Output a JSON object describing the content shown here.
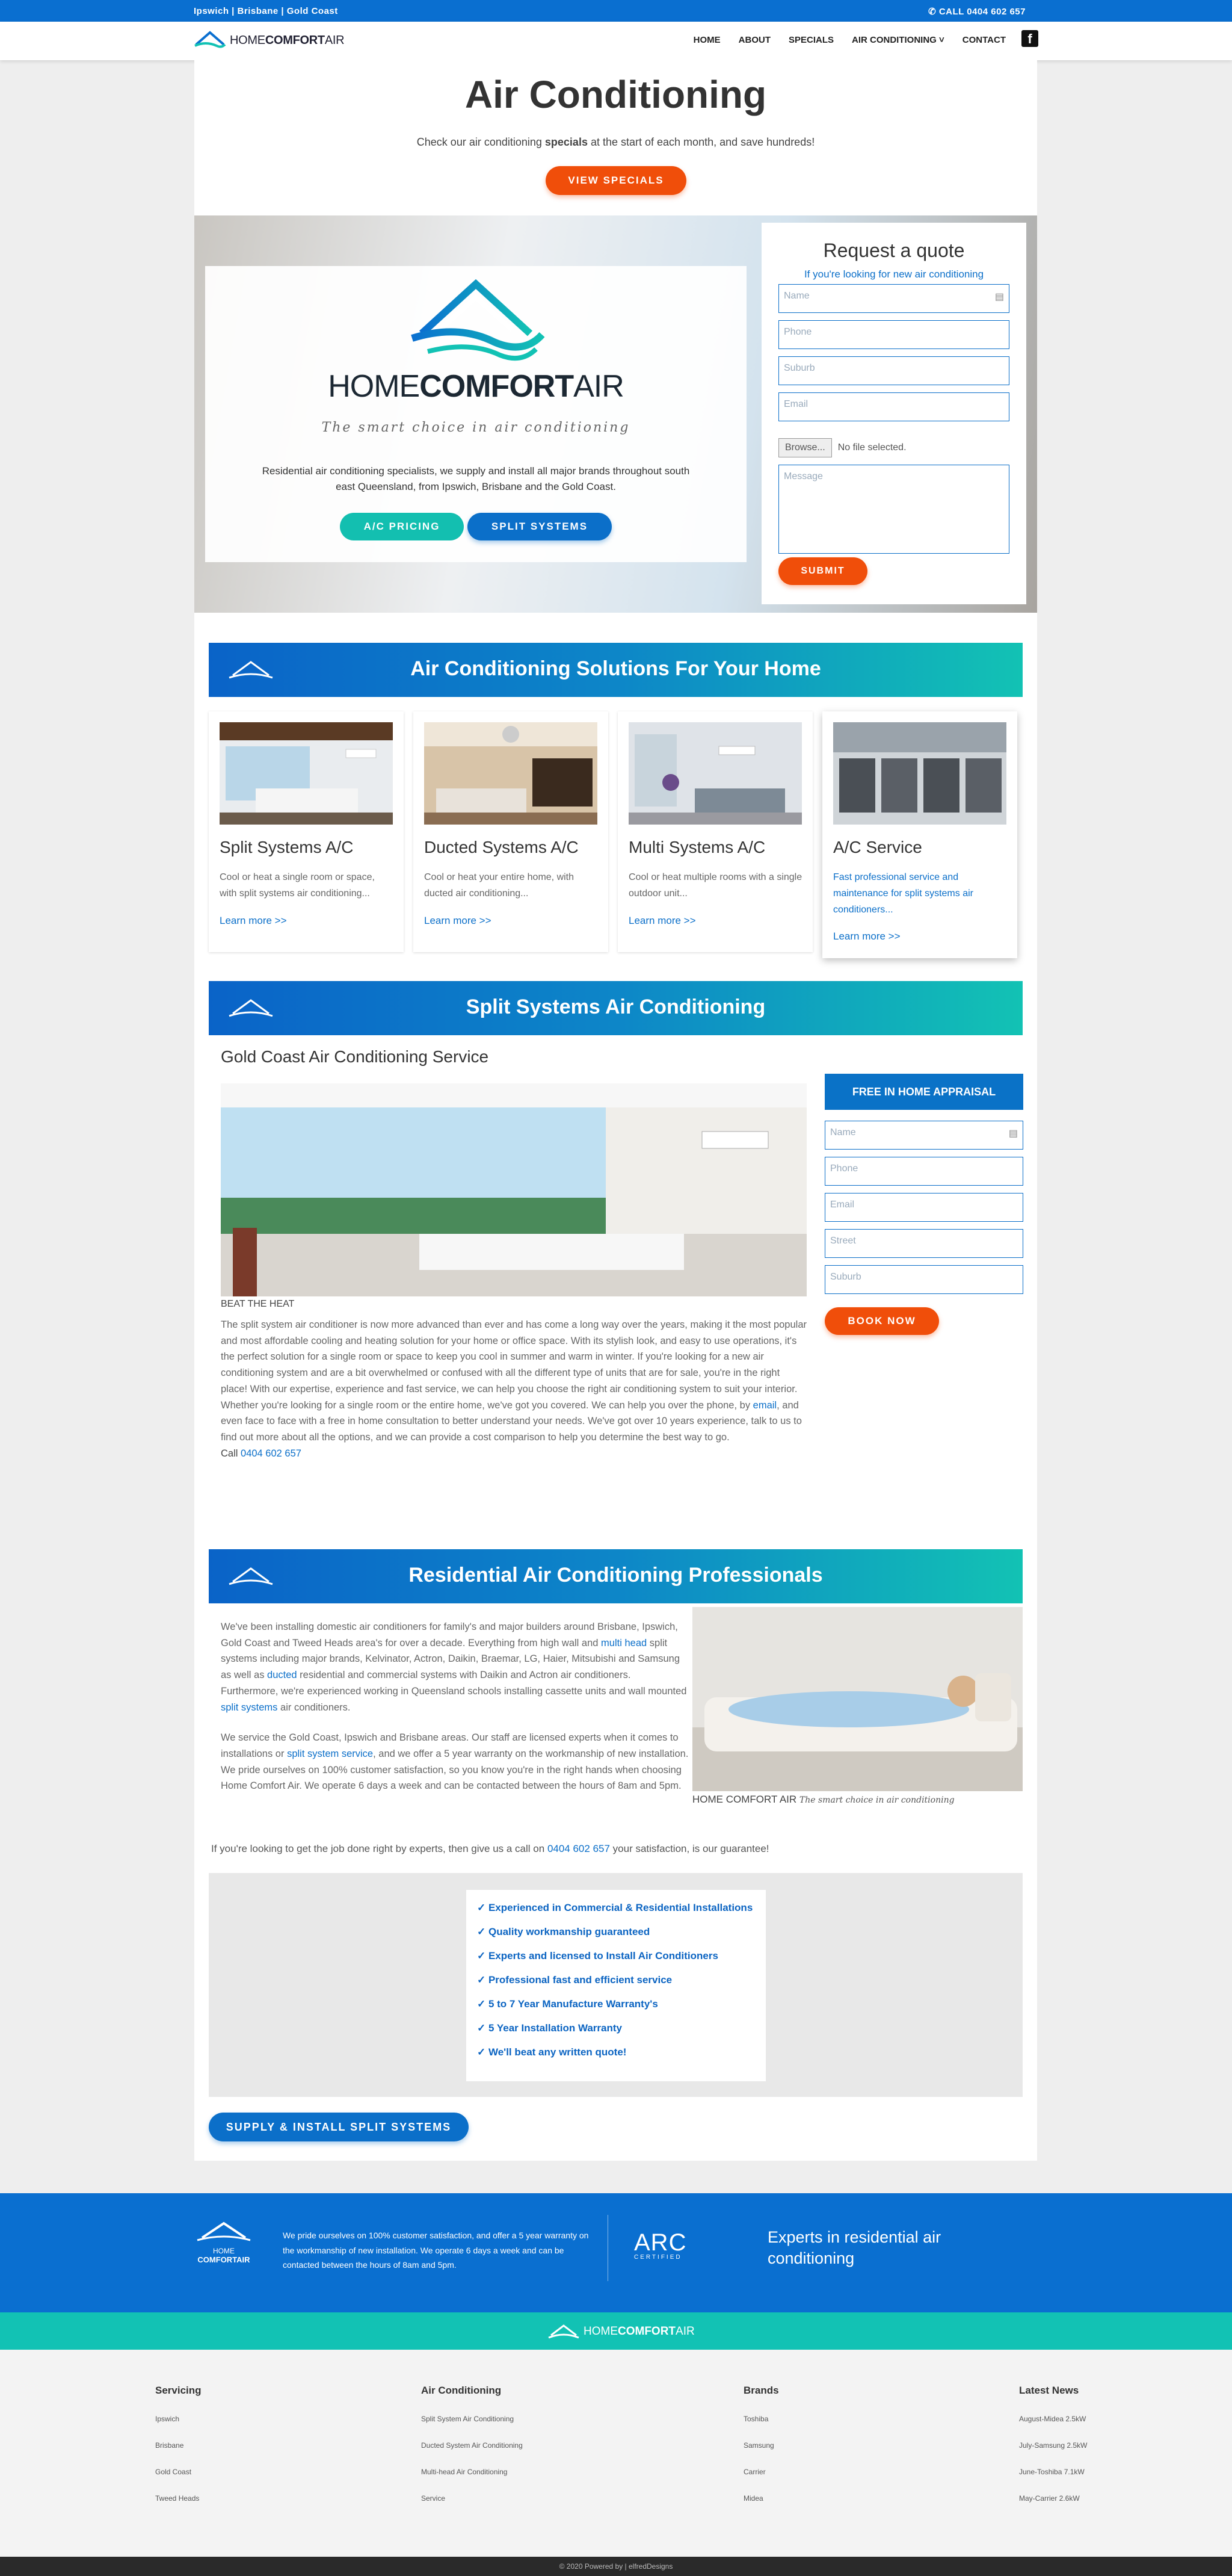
{
  "topbar": {
    "locations": "Ipswich | Brisbane | Gold Coast",
    "call": "CALL 0404 602 657"
  },
  "nav": {
    "logo": {
      "word_light1": "HOME",
      "word_bold": "COMFORT",
      "word_light2": "AIR"
    },
    "items": [
      "HOME",
      "ABOUT",
      "SPECIALS",
      "AIR CONDITIONING",
      "CONTACT"
    ],
    "facebook": "f"
  },
  "header": {
    "title": "Air Conditioning",
    "subtitle_pre": "Check our air conditioning ",
    "subtitle_bold": "specials",
    "subtitle_post": " at the start of each month, and save hundreds!",
    "specials_button": "VIEW SPECIALS"
  },
  "hero": {
    "brand_light1": "HOME",
    "brand_bold": "COMFORT",
    "brand_light2": "AIR",
    "tagline": "The smart choice in air conditioning",
    "description": "Residential air conditioning specialists, we supply and install all major brands throughout south east Queensland, from Ipswich, Brisbane and the Gold Coast.",
    "button_pricing": "A/C PRICING",
    "button_split": "SPLIT SYSTEMS"
  },
  "quote_form": {
    "title": "Request a quote",
    "subtitle": "If you're looking for new air conditioning",
    "name_placeholder": "Name",
    "phone_placeholder": "Phone",
    "suburb_placeholder": "Suburb",
    "email_placeholder": "Email",
    "browse_label": "Browse...",
    "file_status": "No file selected.",
    "message_placeholder": "Message",
    "submit": "SUBMIT"
  },
  "solutions": {
    "title": "Air Conditioning Solutions For Your Home",
    "cards": [
      {
        "title": "Split Systems A/C",
        "text": "Cool or heat a single room or space, with split systems air conditioning...",
        "link": "Learn more >>"
      },
      {
        "title": "Ducted Systems A/C",
        "text": "Cool or heat your entire home, with ducted air conditioning...",
        "link": "Learn more >>"
      },
      {
        "title": "Multi Systems A/C",
        "text": "Cool or heat multiple rooms with a single outdoor unit...",
        "link": "Learn more >>"
      },
      {
        "title": "A/C Service",
        "text": "Fast professional service and maintenance for split systems air conditioners...",
        "link": "Learn more >>"
      }
    ]
  },
  "split_section": {
    "title": "Split Systems Air Conditioning",
    "subtitle": "Gold Coast Air Conditioning Service",
    "caption": "BEAT THE HEAT",
    "body_a": "The split system air conditioner is now more advanced than ever and has come a long way over the years, making it the most popular and most affordable cooling and heating solution for your home or office space. With its stylish look, and easy to use operations, it's the perfect solution for a single room or space to keep you cool in summer and warm in winter. If you're looking for a new air conditioning system and are a bit overwhelmed or confused with all the different type of units that are for sale, you're in the right place! With our expertise, experience and fast service, we can help you choose the right air conditioning system to suit your interior. Whether you're looking for a single room or the entire home, we've got you covered. We can help you over the phone, by ",
    "body_link": "email",
    "body_b": ", and even face to face with a free in home consultation to better understand your needs. We've got over 10 years experience, talk to us to find out more about all the options, and we can provide a cost comparison to help you determine the best way to go.",
    "call_label": "Call ",
    "phone": "0404 602 657"
  },
  "appraisal": {
    "title": "FREE IN HOME APPRAISAL",
    "name_placeholder": "Name",
    "phone_placeholder": "Phone",
    "email_placeholder": "Email",
    "street_placeholder": "Street",
    "suburb_placeholder": "Suburb",
    "button": "BOOK NOW"
  },
  "residential": {
    "title": "Residential Air Conditioning Professionals",
    "p1_a": "We've been installing domestic air conditioners for family's and major builders around Brisbane, Ipswich, Gold Coast and Tweed Heads area's for over a decade. Everything from high wall and ",
    "p1_link1": "multi head",
    "p1_b": " split systems including major brands, Kelvinator, Actron, Daikin, Braemar, LG, Haier, Mitsubishi and Samsung as well as ",
    "p1_link2": "ducted",
    "p1_c": " residential and commercial systems with Daikin and Actron air conditioners. Furthermore, we're experienced working in Queensland schools installing cassette units and wall mounted ",
    "p1_link3": "split systems",
    "p1_d": " air conditioners.",
    "p2_a": "We service the Gold Coast, Ipswich and Brisbane areas. Our staff are licensed experts when it comes to installations or ",
    "p2_link": "split system service",
    "p2_b": ", and we offer a 5 year warranty on the workmanship of new installation. We pride ourselves on 100% customer satisfaction, so you know you're in the right hands when choosing Home Comfort Air. We operate 6 days a week and can be contacted between the hours of 8am and 5pm.",
    "caption": "HOME COMFORT AIR",
    "caption_tag": "The smart choice in air conditioning",
    "cta_a": "If you're looking to get the job done right by experts, then give us a call on ",
    "cta_phone": "0404 602 657",
    "cta_b": " your satisfaction, is our guarantee!"
  },
  "checklist": [
    "✓ Experienced in Commercial & Residential Installations",
    "✓ Quality workmanship guaranteed",
    "✓ Experts and licensed to Install Air Conditioners",
    "✓ Professional fast and efficient service",
    "✓ 5 to 7 Year Manufacture Warranty's",
    "✓ 5 Year Installation Warranty",
    "✓ We'll beat any written quote!"
  ],
  "supply_button": "SUPPLY & INSTALL SPLIT SYSTEMS",
  "footer": {
    "logo_home": "HOME",
    "logo_comfort": "COMFORTAIR",
    "text": "We pride ourselves on 100% customer satisfaction, and offer a 5 year warranty on the workmanship of new installation. We operate 6 days a week and can be contacted between the hours of 8am and 5pm.",
    "arc": "ARC",
    "arc_sub": "CERTIFIED",
    "tagline": "Experts in residential air conditioning",
    "band_logo": {
      "light1": "HOME",
      "bold": "COMFORT",
      "light2": "AIR"
    },
    "columns": [
      {
        "heading": "Servicing",
        "items": [
          "Ipswich",
          "Brisbane",
          "Gold Coast",
          "Tweed Heads"
        ]
      },
      {
        "heading": "Air Conditioning",
        "items": [
          "Split System Air Conditioning",
          "Ducted System Air Conditioning",
          "Multi-head Air Conditioning",
          "Service"
        ]
      },
      {
        "heading": "Brands",
        "items": [
          "Toshiba",
          "Samsung",
          "Carrier",
          "Midea"
        ]
      },
      {
        "heading": "Latest News",
        "items": [
          "August-Midea 2.5kW",
          "July-Samsung 2.5kW",
          "June-Toshiba 7.1kW",
          "May-Carrier 2.6kW"
        ]
      }
    ],
    "copyright": "© 2020 Powered by | elfredDesigns"
  },
  "colors": {
    "brand_blue": "#0a6fd0",
    "teal": "#12c2b4",
    "orange": "#f04e0a"
  }
}
